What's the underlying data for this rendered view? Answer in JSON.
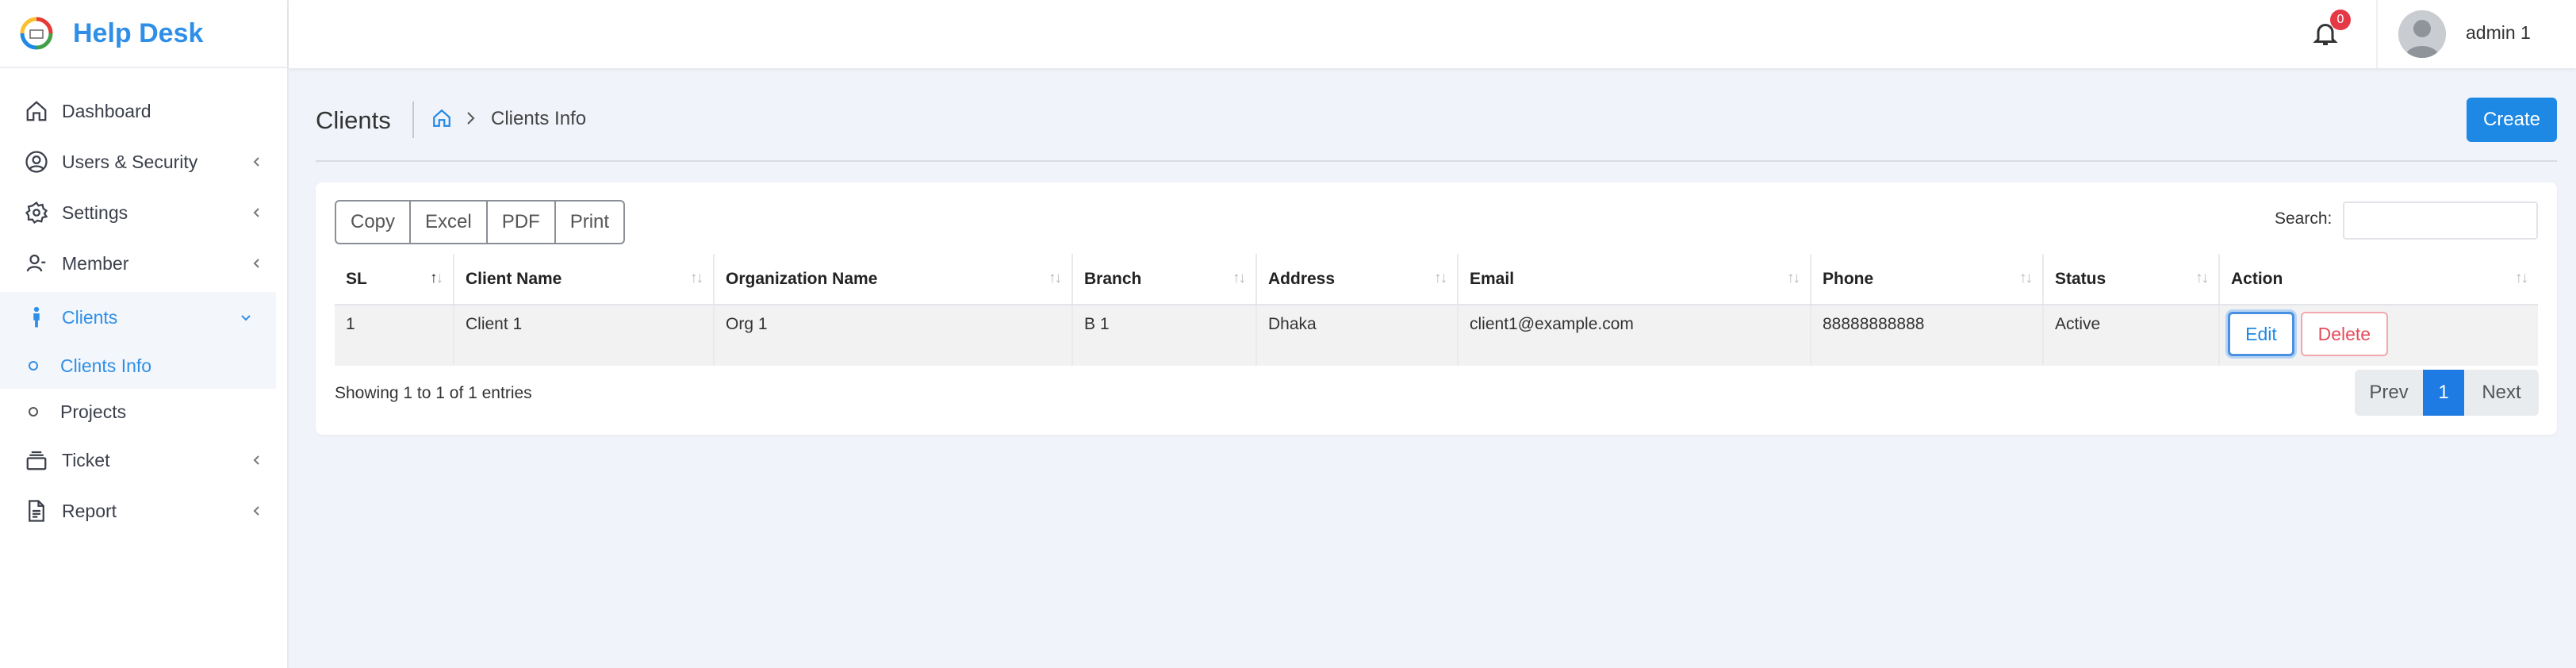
{
  "brand": {
    "title": "Help Desk",
    "logo_icon": "helpdesk-logo"
  },
  "sidebar": {
    "items": [
      {
        "label": "Dashboard",
        "icon": "home-icon"
      },
      {
        "label": "Users & Security",
        "icon": "user-circle-icon"
      },
      {
        "label": "Settings",
        "icon": "gear-icon"
      },
      {
        "label": "Member",
        "icon": "person-icon"
      },
      {
        "label": "Clients",
        "icon": "person-standing-icon"
      },
      {
        "label": "Ticket",
        "icon": "stack-icon"
      },
      {
        "label": "Report",
        "icon": "document-icon"
      }
    ],
    "clients_sub": [
      {
        "label": "Clients Info"
      },
      {
        "label": "Projects"
      }
    ]
  },
  "topbar": {
    "notification_count": "0",
    "username": "admin 1"
  },
  "page": {
    "title": "Clients",
    "breadcrumb_current": "Clients Info",
    "create_label": "Create"
  },
  "toolbar": {
    "copy": "Copy",
    "excel": "Excel",
    "pdf": "PDF",
    "print": "Print",
    "search_label": "Search:",
    "search_value": ""
  },
  "table": {
    "columns": [
      "SL",
      "Client Name",
      "Organization Name",
      "Branch",
      "Address",
      "Email",
      "Phone",
      "Status",
      "Action"
    ],
    "rows": [
      {
        "sl": "1",
        "client_name": "Client 1",
        "organization": "Org 1",
        "branch": "B 1",
        "address": "Dhaka",
        "email": "client1@example.com",
        "phone": "88888888888",
        "status": "Active",
        "edit": "Edit",
        "delete": "Delete"
      }
    ]
  },
  "footer": {
    "showing": "Showing 1 to 1 of 1 entries",
    "prev": "Prev",
    "page": "1",
    "next": "Next"
  },
  "colors": {
    "accent": "#1e88e5",
    "brand": "#2f8fe8",
    "danger": "#e54b5c",
    "badge": "#e63946"
  }
}
